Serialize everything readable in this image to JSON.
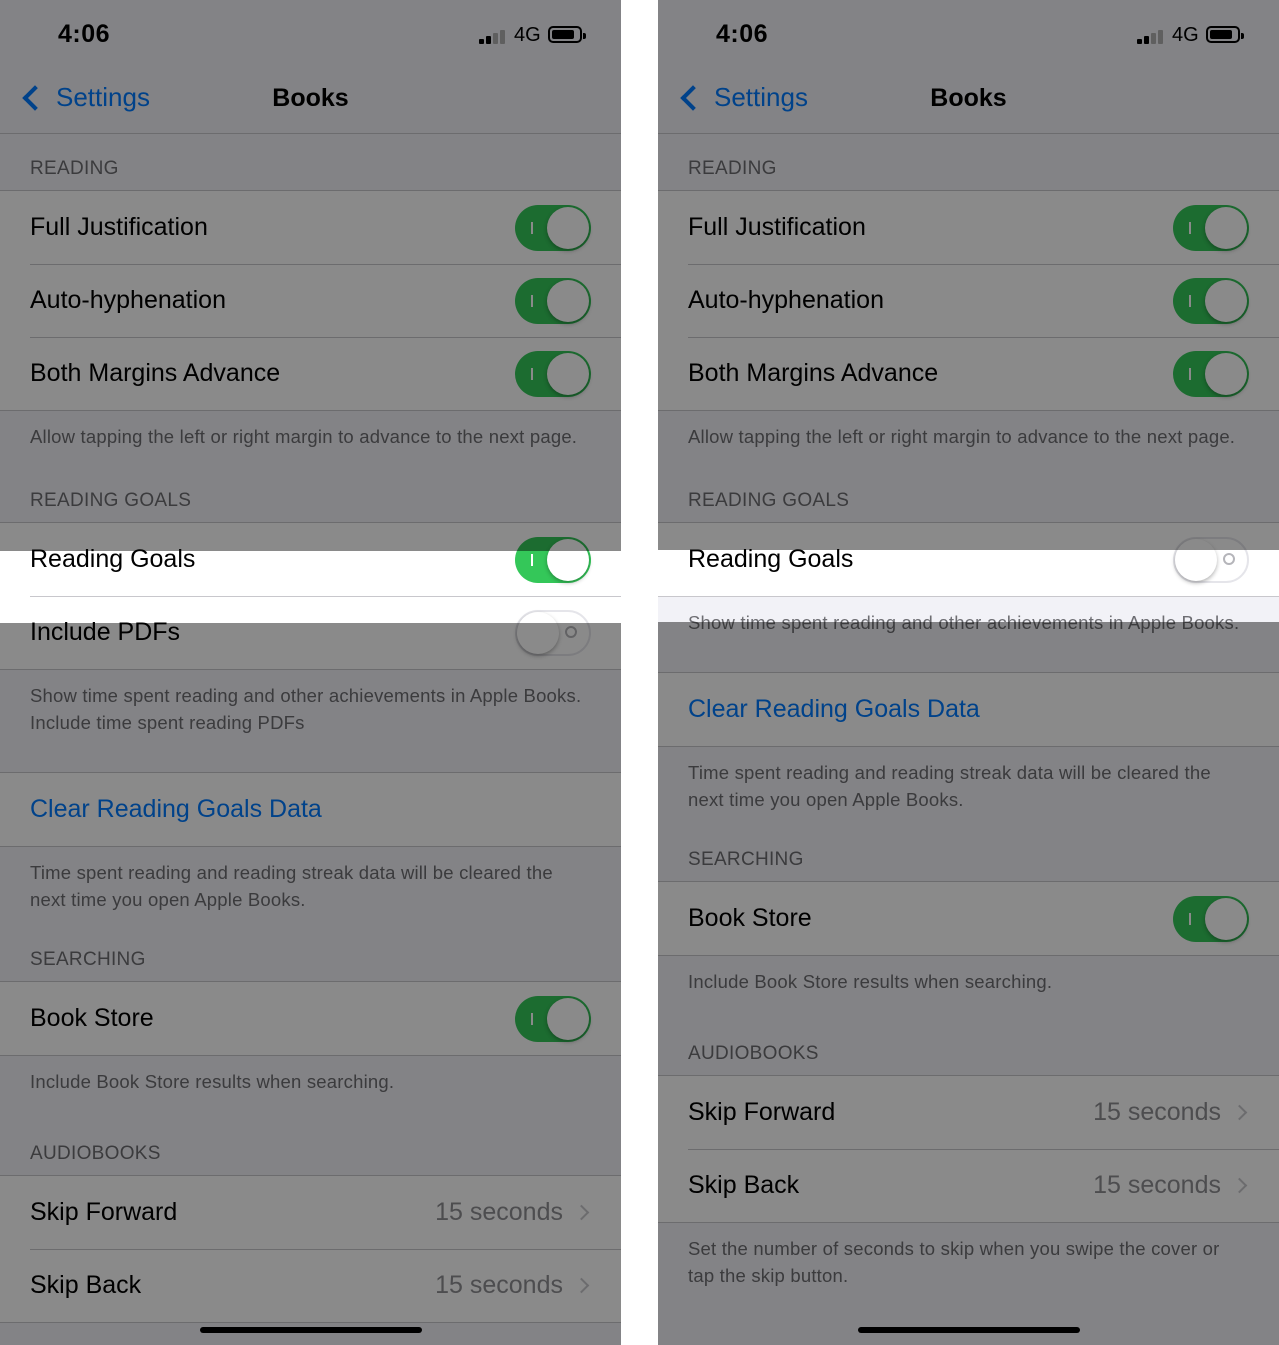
{
  "left_screen": {
    "status": {
      "time": "4:06",
      "network": "4G"
    },
    "nav": {
      "back_label": "Settings",
      "title": "Books"
    },
    "reading": {
      "header": "READING",
      "rows": [
        {
          "label": "Full Justification",
          "toggle": "on"
        },
        {
          "label": "Auto-hyphenation",
          "toggle": "on"
        },
        {
          "label": "Both Margins Advance",
          "toggle": "on"
        }
      ],
      "footer": "Allow tapping the left or right margin to advance to the next page."
    },
    "reading_goals": {
      "header": "READING GOALS",
      "rows": [
        {
          "label": "Reading Goals",
          "toggle": "on"
        },
        {
          "label": "Include PDFs",
          "toggle": "off"
        }
      ],
      "footer": "Show time spent reading and other achievements in Apple Books. Include time spent reading PDFs"
    },
    "clear": {
      "label": "Clear Reading Goals Data",
      "footer": "Time spent reading and reading streak data will be cleared the next time you open Apple Books."
    },
    "searching": {
      "header": "SEARCHING",
      "rows": [
        {
          "label": "Book Store",
          "toggle": "on"
        }
      ],
      "footer": "Include Book Store results when searching."
    },
    "audiobooks": {
      "header": "AUDIOBOOKS",
      "rows": [
        {
          "label": "Skip Forward",
          "value": "15 seconds"
        },
        {
          "label": "Skip Back",
          "value": "15 seconds"
        }
      ]
    }
  },
  "right_screen": {
    "status": {
      "time": "4:06",
      "network": "4G"
    },
    "nav": {
      "back_label": "Settings",
      "title": "Books"
    },
    "reading": {
      "header": "READING",
      "rows": [
        {
          "label": "Full Justification",
          "toggle": "on"
        },
        {
          "label": "Auto-hyphenation",
          "toggle": "on"
        },
        {
          "label": "Both Margins Advance",
          "toggle": "on"
        }
      ],
      "footer": "Allow tapping the left or right margin to advance to the next page."
    },
    "reading_goals": {
      "header": "READING GOALS",
      "rows": [
        {
          "label": "Reading Goals",
          "toggle": "off"
        }
      ],
      "footer": "Show time spent reading and other achievements in Apple Books."
    },
    "clear": {
      "label": "Clear Reading Goals Data",
      "footer": "Time spent reading and reading streak data will be cleared the next time you open Apple Books."
    },
    "searching": {
      "header": "SEARCHING",
      "rows": [
        {
          "label": "Book Store",
          "toggle": "on"
        }
      ],
      "footer": "Include Book Store results when searching."
    },
    "audiobooks": {
      "header": "AUDIOBOOKS",
      "rows": [
        {
          "label": "Skip Forward",
          "value": "15 seconds"
        },
        {
          "label": "Skip Back",
          "value": "15 seconds"
        }
      ],
      "footer": "Set the number of seconds to skip when you swipe the cover or tap the skip button."
    }
  },
  "colors": {
    "toggle_on": "#34c759",
    "link": "#007aff",
    "dim_overlay": "rgba(0,0,0,0.46)"
  }
}
